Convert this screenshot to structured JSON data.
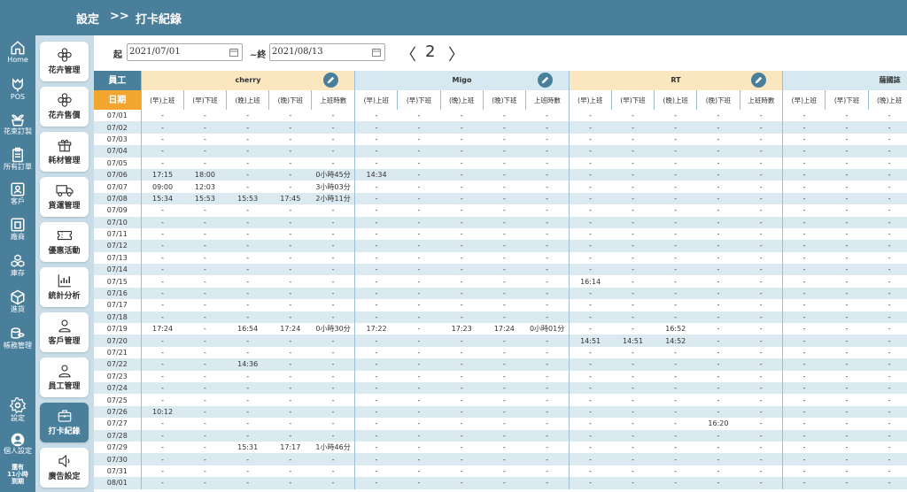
{
  "breadcrumb": {
    "section": "設定",
    "separator": ">>",
    "page": "打卡紀錄"
  },
  "rail": [
    {
      "label": "Home",
      "icon": "home-icon"
    },
    {
      "label": "POS",
      "icon": "tulip-icon"
    },
    {
      "label": "花束訂製",
      "icon": "plant-pot-icon"
    },
    {
      "label": "所有訂單",
      "icon": "clipboard-icon"
    },
    {
      "label": "客戶",
      "icon": "contact-card-icon"
    },
    {
      "label": "廠商",
      "icon": "building-card-icon"
    },
    {
      "label": "庫存",
      "icon": "boxes-icon"
    },
    {
      "label": "進貨",
      "icon": "package-icon"
    },
    {
      "label": "帳務管理",
      "icon": "coins-icon"
    },
    {
      "label": "設定",
      "icon": "gear-icon"
    },
    {
      "label": "個人設定",
      "icon": "user-avatar-icon"
    },
    {
      "label": "還有",
      "icon": ""
    },
    {
      "label": "11小時",
      "icon": ""
    },
    {
      "label": "到期",
      "icon": ""
    }
  ],
  "menu": [
    {
      "label": "花卉管理",
      "icon": "flower-icon"
    },
    {
      "label": "花卉售價",
      "icon": "flower-icon"
    },
    {
      "label": "耗材管理",
      "icon": "gift-box-icon"
    },
    {
      "label": "貨運管理",
      "icon": "truck-icon"
    },
    {
      "label": "優惠活動",
      "icon": "coupon-icon"
    },
    {
      "label": "統計分析",
      "icon": "chart-icon"
    },
    {
      "label": "客戶管理",
      "icon": "user-icon"
    },
    {
      "label": "員工管理",
      "icon": "user-icon"
    },
    {
      "label": "打卡紀錄",
      "icon": "briefcase-icon"
    },
    {
      "label": "廣告設定",
      "icon": "speaker-icon"
    }
  ],
  "filter": {
    "start_label": "起",
    "start_date": "2021/07/01",
    "end_label": "~終",
    "end_date": "2021/08/13",
    "prev": "〈",
    "page": "2",
    "next": "〉"
  },
  "table": {
    "employee_label": "員工",
    "date_label": "日期",
    "employees": [
      "cherry",
      "Migo",
      "RT",
      "薩國誌"
    ],
    "subcolumns": [
      "(早)上班",
      "(早)下班",
      "(晚)上班",
      "(晚)下班",
      "上班時數"
    ],
    "rows": [
      {
        "date": "07/01",
        "cells": [
          [
            "-",
            "-",
            "-",
            "-",
            "-"
          ],
          [
            "-",
            "-",
            "-",
            "-",
            "-"
          ],
          [
            "-",
            "-",
            "-",
            "-",
            "-"
          ],
          [
            "-",
            "-",
            "-",
            "-",
            "-"
          ]
        ]
      },
      {
        "date": "07/02",
        "cells": [
          [
            "-",
            "-",
            "-",
            "-",
            "-"
          ],
          [
            "-",
            "-",
            "-",
            "-",
            "-"
          ],
          [
            "-",
            "-",
            "-",
            "-",
            "-"
          ],
          [
            "-",
            "-",
            "-",
            "-",
            "-"
          ]
        ]
      },
      {
        "date": "07/03",
        "cells": [
          [
            "-",
            "-",
            "-",
            "-",
            "-"
          ],
          [
            "-",
            "-",
            "-",
            "-",
            "-"
          ],
          [
            "-",
            "-",
            "-",
            "-",
            "-"
          ],
          [
            "-",
            "-",
            "-",
            "-",
            "-"
          ]
        ]
      },
      {
        "date": "07/04",
        "cells": [
          [
            "-",
            "-",
            "-",
            "-",
            "-"
          ],
          [
            "-",
            "-",
            "-",
            "-",
            "-"
          ],
          [
            "-",
            "-",
            "-",
            "-",
            "-"
          ],
          [
            "-",
            "-",
            "-",
            "-",
            "-"
          ]
        ]
      },
      {
        "date": "07/05",
        "cells": [
          [
            "-",
            "-",
            "-",
            "-",
            "-"
          ],
          [
            "-",
            "-",
            "-",
            "-",
            "-"
          ],
          [
            "-",
            "-",
            "-",
            "-",
            "-"
          ],
          [
            "-",
            "-",
            "-",
            "-",
            "-"
          ]
        ]
      },
      {
        "date": "07/06",
        "cells": [
          [
            "17:15",
            "18:00",
            "-",
            "-",
            "0小時45分"
          ],
          [
            "14:34",
            "-",
            "-",
            "-",
            "-"
          ],
          [
            "-",
            "-",
            "-",
            "-",
            "-"
          ],
          [
            "-",
            "-",
            "-",
            "-",
            "-"
          ]
        ]
      },
      {
        "date": "07/07",
        "cells": [
          [
            "09:00",
            "12:03",
            "-",
            "-",
            "3小時03分"
          ],
          [
            "-",
            "-",
            "-",
            "-",
            "-"
          ],
          [
            "-",
            "-",
            "-",
            "-",
            "-"
          ],
          [
            "-",
            "-",
            "-",
            "-",
            "-"
          ]
        ]
      },
      {
        "date": "07/08",
        "cells": [
          [
            "15:34",
            "15:53",
            "15:53",
            "17:45",
            "2小時11分"
          ],
          [
            "-",
            "-",
            "-",
            "-",
            "-"
          ],
          [
            "-",
            "-",
            "-",
            "-",
            "-"
          ],
          [
            "-",
            "-",
            "-",
            "-",
            "-"
          ]
        ]
      },
      {
        "date": "07/09",
        "cells": [
          [
            "-",
            "-",
            "-",
            "-",
            "-"
          ],
          [
            "-",
            "-",
            "-",
            "-",
            "-"
          ],
          [
            "-",
            "-",
            "-",
            "-",
            "-"
          ],
          [
            "-",
            "-",
            "-",
            "-",
            "-"
          ]
        ]
      },
      {
        "date": "07/10",
        "cells": [
          [
            "-",
            "-",
            "-",
            "-",
            "-"
          ],
          [
            "-",
            "-",
            "-",
            "-",
            "-"
          ],
          [
            "-",
            "-",
            "-",
            "-",
            "-"
          ],
          [
            "-",
            "-",
            "-",
            "-",
            "-"
          ]
        ]
      },
      {
        "date": "07/11",
        "cells": [
          [
            "-",
            "-",
            "-",
            "-",
            "-"
          ],
          [
            "-",
            "-",
            "-",
            "-",
            "-"
          ],
          [
            "-",
            "-",
            "-",
            "-",
            "-"
          ],
          [
            "-",
            "-",
            "-",
            "-",
            "-"
          ]
        ]
      },
      {
        "date": "07/12",
        "cells": [
          [
            "-",
            "-",
            "-",
            "-",
            "-"
          ],
          [
            "-",
            "-",
            "-",
            "-",
            "-"
          ],
          [
            "-",
            "-",
            "-",
            "-",
            "-"
          ],
          [
            "-",
            "-",
            "-",
            "-",
            "-"
          ]
        ]
      },
      {
        "date": "07/13",
        "cells": [
          [
            "-",
            "-",
            "-",
            "-",
            "-"
          ],
          [
            "-",
            "-",
            "-",
            "-",
            "-"
          ],
          [
            "-",
            "-",
            "-",
            "-",
            "-"
          ],
          [
            "-",
            "-",
            "-",
            "-",
            "-"
          ]
        ]
      },
      {
        "date": "07/14",
        "cells": [
          [
            "-",
            "-",
            "-",
            "-",
            "-"
          ],
          [
            "-",
            "-",
            "-",
            "-",
            "-"
          ],
          [
            "-",
            "-",
            "-",
            "-",
            "-"
          ],
          [
            "-",
            "-",
            "-",
            "-",
            "-"
          ]
        ]
      },
      {
        "date": "07/15",
        "cells": [
          [
            "-",
            "-",
            "-",
            "-",
            "-"
          ],
          [
            "-",
            "-",
            "-",
            "-",
            "-"
          ],
          [
            "16:14",
            "-",
            "-",
            "-",
            "-"
          ],
          [
            "-",
            "-",
            "-",
            "-",
            "-"
          ]
        ]
      },
      {
        "date": "07/16",
        "cells": [
          [
            "-",
            "-",
            "-",
            "-",
            "-"
          ],
          [
            "-",
            "-",
            "-",
            "-",
            "-"
          ],
          [
            "-",
            "-",
            "-",
            "-",
            "-"
          ],
          [
            "-",
            "-",
            "-",
            "-",
            "-"
          ]
        ]
      },
      {
        "date": "07/17",
        "cells": [
          [
            "-",
            "-",
            "-",
            "-",
            "-"
          ],
          [
            "-",
            "-",
            "-",
            "-",
            "-"
          ],
          [
            "-",
            "-",
            "-",
            "-",
            "-"
          ],
          [
            "-",
            "-",
            "-",
            "-",
            "-"
          ]
        ]
      },
      {
        "date": "07/18",
        "cells": [
          [
            "-",
            "-",
            "-",
            "-",
            "-"
          ],
          [
            "-",
            "-",
            "-",
            "-",
            "-"
          ],
          [
            "-",
            "-",
            "-",
            "-",
            "-"
          ],
          [
            "-",
            "-",
            "-",
            "-",
            "-"
          ]
        ]
      },
      {
        "date": "07/19",
        "cells": [
          [
            "17:24",
            "-",
            "16:54",
            "17:24",
            "0小時30分"
          ],
          [
            "17:22",
            "-",
            "17:23",
            "17:24",
            "0小時01分"
          ],
          [
            "-",
            "-",
            "16:52",
            "-",
            "-"
          ],
          [
            "-",
            "-",
            "-",
            "-",
            "-"
          ]
        ]
      },
      {
        "date": "07/20",
        "cells": [
          [
            "-",
            "-",
            "-",
            "-",
            "-"
          ],
          [
            "-",
            "-",
            "-",
            "-",
            "-"
          ],
          [
            "14:51",
            "14:51",
            "14:52",
            "-",
            "-"
          ],
          [
            "-",
            "-",
            "-",
            "-",
            "-"
          ]
        ]
      },
      {
        "date": "07/21",
        "cells": [
          [
            "-",
            "-",
            "-",
            "-",
            "-"
          ],
          [
            "-",
            "-",
            "-",
            "-",
            "-"
          ],
          [
            "-",
            "-",
            "-",
            "-",
            "-"
          ],
          [
            "-",
            "-",
            "-",
            "-",
            "-"
          ]
        ]
      },
      {
        "date": "07/22",
        "cells": [
          [
            "-",
            "-",
            "14:36",
            "-",
            "-"
          ],
          [
            "-",
            "-",
            "-",
            "-",
            "-"
          ],
          [
            "-",
            "-",
            "-",
            "-",
            "-"
          ],
          [
            "-",
            "-",
            "-",
            "-",
            "-"
          ]
        ]
      },
      {
        "date": "07/23",
        "cells": [
          [
            "-",
            "-",
            "-",
            "-",
            "-"
          ],
          [
            "-",
            "-",
            "-",
            "-",
            "-"
          ],
          [
            "-",
            "-",
            "-",
            "-",
            "-"
          ],
          [
            "-",
            "-",
            "-",
            "-",
            "-"
          ]
        ]
      },
      {
        "date": "07/24",
        "cells": [
          [
            "-",
            "-",
            "-",
            "-",
            "-"
          ],
          [
            "-",
            "-",
            "-",
            "-",
            "-"
          ],
          [
            "-",
            "-",
            "-",
            "-",
            "-"
          ],
          [
            "-",
            "-",
            "-",
            "-",
            "-"
          ]
        ]
      },
      {
        "date": "07/25",
        "cells": [
          [
            "-",
            "-",
            "-",
            "-",
            "-"
          ],
          [
            "-",
            "-",
            "-",
            "-",
            "-"
          ],
          [
            "-",
            "-",
            "-",
            "-",
            "-"
          ],
          [
            "-",
            "-",
            "-",
            "-",
            "-"
          ]
        ]
      },
      {
        "date": "07/26",
        "cells": [
          [
            "10:12",
            "-",
            "-",
            "-",
            "-"
          ],
          [
            "-",
            "-",
            "-",
            "-",
            "-"
          ],
          [
            "-",
            "-",
            "-",
            "-",
            "-"
          ],
          [
            "-",
            "-",
            "-",
            "-",
            "-"
          ]
        ]
      },
      {
        "date": "07/27",
        "cells": [
          [
            "-",
            "-",
            "-",
            "-",
            "-"
          ],
          [
            "-",
            "-",
            "-",
            "-",
            "-"
          ],
          [
            "-",
            "-",
            "-",
            "16:20",
            "-"
          ],
          [
            "-",
            "-",
            "-",
            "-",
            "-"
          ]
        ]
      },
      {
        "date": "07/28",
        "cells": [
          [
            "-",
            "-",
            "-",
            "-",
            "-"
          ],
          [
            "-",
            "-",
            "-",
            "-",
            "-"
          ],
          [
            "-",
            "-",
            "-",
            "-",
            "-"
          ],
          [
            "-",
            "-",
            "-",
            "-",
            "-"
          ]
        ]
      },
      {
        "date": "07/29",
        "cells": [
          [
            "-",
            "-",
            "15:31",
            "17:17",
            "1小時46分"
          ],
          [
            "-",
            "-",
            "-",
            "-",
            "-"
          ],
          [
            "-",
            "-",
            "-",
            "-",
            "-"
          ],
          [
            "-",
            "-",
            "-",
            "-",
            "-"
          ]
        ]
      },
      {
        "date": "07/30",
        "cells": [
          [
            "-",
            "-",
            "-",
            "-",
            "-"
          ],
          [
            "-",
            "-",
            "-",
            "-",
            "-"
          ],
          [
            "-",
            "-",
            "-",
            "-",
            "-"
          ],
          [
            "-",
            "-",
            "-",
            "-",
            "-"
          ]
        ]
      },
      {
        "date": "07/31",
        "cells": [
          [
            "-",
            "-",
            "-",
            "-",
            "-"
          ],
          [
            "-",
            "-",
            "-",
            "-",
            "-"
          ],
          [
            "-",
            "-",
            "-",
            "-",
            "-"
          ],
          [
            "-",
            "-",
            "-",
            "-",
            "-"
          ]
        ]
      },
      {
        "date": "08/01",
        "cells": [
          [
            "-",
            "-",
            "-",
            "-",
            "-"
          ],
          [
            "-",
            "-",
            "-",
            "-",
            "-"
          ],
          [
            "-",
            "-",
            "-",
            "-",
            "-"
          ],
          [
            "-",
            "-",
            "-",
            "-",
            "-"
          ]
        ]
      }
    ]
  },
  "colors": {
    "brand": "#4a7f9c",
    "sidebar_bg": "#c8dde7",
    "date_accent": "#f2a630",
    "header_cherry": "#fbe7bf",
    "header_migo": "#d6e8f0",
    "header_rt": "#fbe7bf",
    "header_4": "#d6e8f0",
    "row_stripe": "#dbe9f0"
  }
}
